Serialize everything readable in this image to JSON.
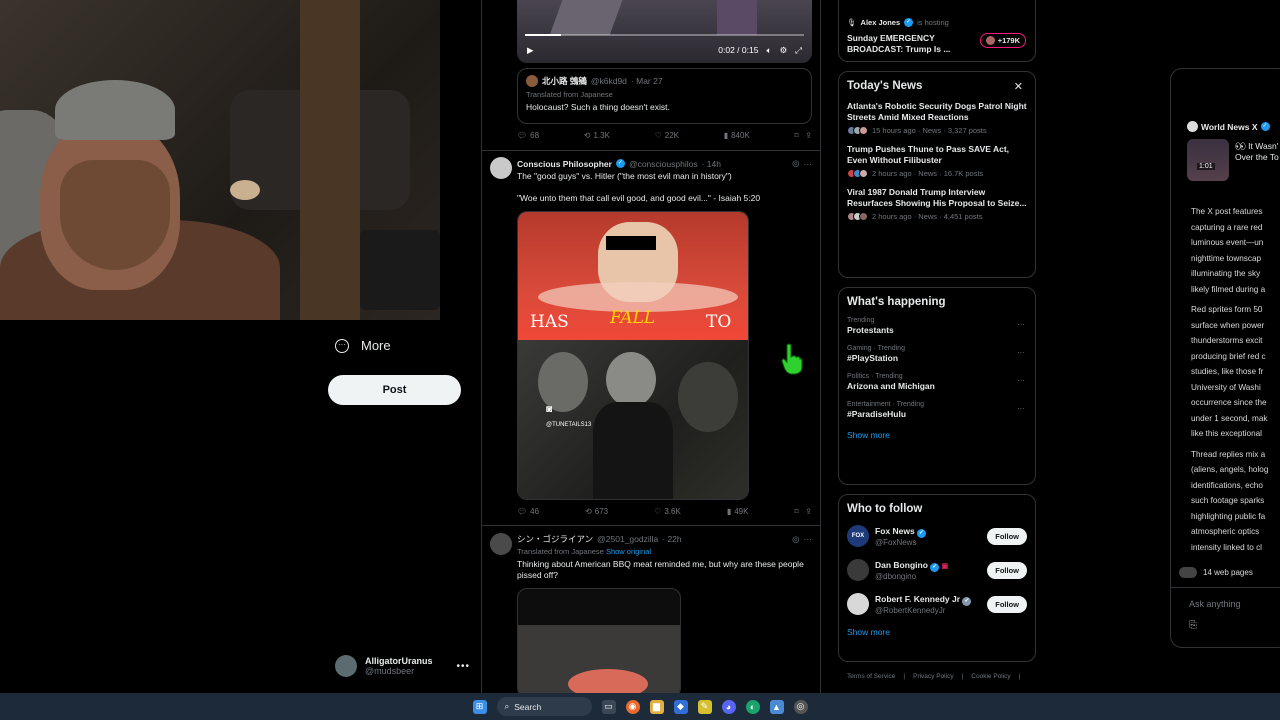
{
  "nav": {
    "more_label": "More",
    "post_label": "Post",
    "account": {
      "name": "AlligatorUranus",
      "handle": "@mudsbeer"
    }
  },
  "feed": {
    "video": {
      "time": "0:02 / 0:15",
      "progress": 0.13
    },
    "quote": {
      "name": "北小路 鵼鵷",
      "handle": "@k6kd9d",
      "date": "· Mar 27",
      "translated": "Translated from Japanese",
      "text": "Holocaust? Such a thing doesn't exist."
    },
    "tweet1_actions": {
      "replies": "68",
      "reposts": "1.3K",
      "likes": "22K",
      "views": "840K"
    },
    "tweet2": {
      "name": "Conscious Philosopher",
      "handle": "@consciousphilos",
      "time": "· 14h",
      "line1": "The \"good guys\" vs. Hitler (\"the most evil man in history\")",
      "line2": "\"Woe unto them that call evil good, and good evil...\" - Isaiah 5:20",
      "media_words": [
        "HAS",
        "FALL",
        "TO"
      ],
      "watermark": "@TUNETAILS13"
    },
    "tweet2_actions": {
      "replies": "46",
      "reposts": "673",
      "likes": "3.6K",
      "views": "49K"
    },
    "tweet3": {
      "name": "シン・ゴジライアン",
      "handle": "@2501_godzilla",
      "time": "· 22h",
      "translated": "Translated from Japanese",
      "show_original": "Show original",
      "text": "Thinking about American BBQ meat reminded me, but why are these people pissed off?"
    }
  },
  "live": {
    "host_name": "Alex Jones",
    "hosting": "is hosting",
    "title": "Sunday EMERGENCY BROADCAST: Trump Is ...",
    "listeners": "+179K"
  },
  "news": {
    "title": "Today's News",
    "items": [
      {
        "title": "Atlanta's Robotic Security Dogs Patrol Night Streets Amid Mixed Reactions",
        "meta": "15 hours ago · News · 3,327 posts"
      },
      {
        "title": "Trump Pushes Thune to Pass SAVE Act, Even Without Filibuster",
        "meta": "2 hours ago · News · 16.7K posts"
      },
      {
        "title": "Viral 1987 Donald Trump Interview Resurfaces Showing His Proposal to Seize...",
        "meta": "2 hours ago · News · 4,451 posts"
      }
    ]
  },
  "happening": {
    "title": "What's happening",
    "items": [
      {
        "category": "Trending",
        "name": "Protestants"
      },
      {
        "category": "Gaming · Trending",
        "name": "#PlayStation"
      },
      {
        "category": "Politics · Trending",
        "name": "Arizona and Michigan"
      },
      {
        "category": "Entertainment · Trending",
        "name": "#ParadiseHulu"
      }
    ],
    "show_more": "Show more"
  },
  "who_to_follow": {
    "title": "Who to follow",
    "items": [
      {
        "name": "Fox News",
        "handle": "@FoxNews",
        "button": "Follow"
      },
      {
        "name": "Dan Bongino",
        "handle": "@dbongino",
        "button": "Follow"
      },
      {
        "name": "Robert F. Kennedy Jr",
        "handle": "@RobertKennedyJr",
        "button": "Follow"
      }
    ],
    "show_more": "Show more"
  },
  "footer": [
    "Terms of Service",
    "Privacy Policy",
    "Cookie Policy"
  ],
  "grok": {
    "source_name": "World News X",
    "source_text1": "It Wasn'",
    "source_text2": "Over the To",
    "video_time": "1:01",
    "bullets": [
      [
        "The X post features",
        "capturing a rare red",
        "luminous event—un",
        "nighttime townscap",
        "illuminating the sky",
        "likely filmed during a"
      ],
      [
        "Red sprites form 50",
        "surface when power",
        "thunderstorms excit",
        "producing brief red c",
        "studies, like those fr",
        "University of Washi",
        "occurrence since the",
        "under 1 second, mak",
        "like this exceptional"
      ],
      [
        "Thread replies mix a",
        "(aliens, angels, holog",
        "identifications, echo",
        "such footage sparks",
        "highlighting public fa",
        "atmospheric optics",
        "intensity linked to cl"
      ]
    ],
    "web_pages": "14 web pages",
    "ask_placeholder": "Ask anything"
  },
  "taskbar": {
    "search_label": "Search"
  }
}
